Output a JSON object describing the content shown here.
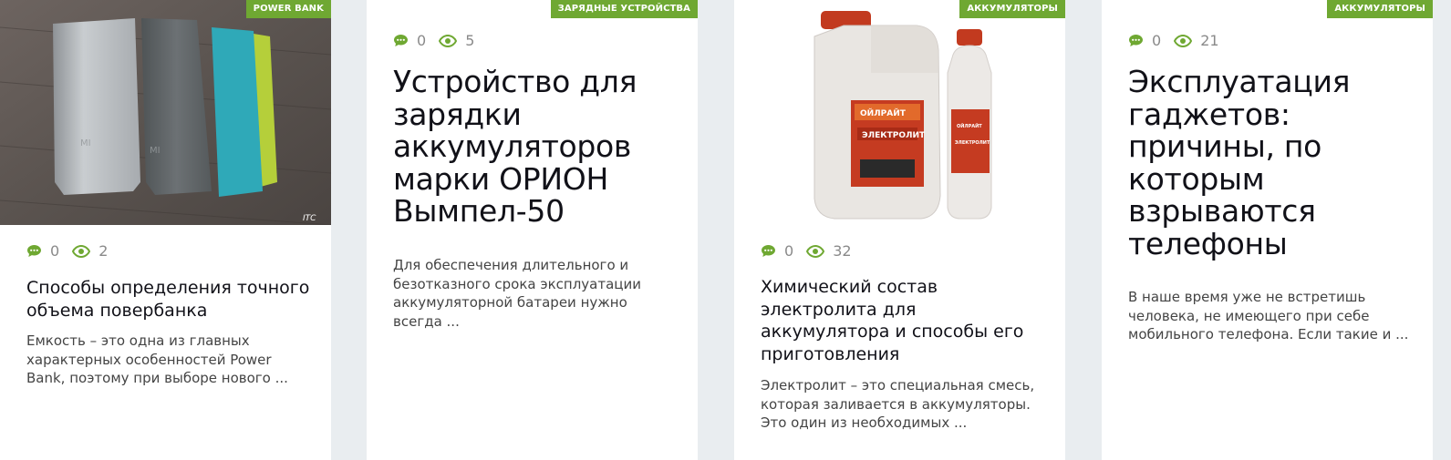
{
  "accent_color": "#6fa832",
  "cards": [
    {
      "category": "Power Bank",
      "comments": "0",
      "views": "2",
      "title": "Способы определения точного объема повербанка",
      "excerpt": "Емкость – это одна из главных характерных особенностей Power Bank, поэтому при выборе нового ...",
      "image_caption": "ITC"
    },
    {
      "category": "Зарядные устройства",
      "comments": "0",
      "views": "5",
      "title": "Устройство для зарядки аккумуляторов марки ОРИОН Вымпел-50",
      "excerpt": "Для обеспечения длительного и безотказного срока эксплуатации аккумуляторной батареи нужно всегда ..."
    },
    {
      "category": "Аккумуляторы",
      "comments": "0",
      "views": "32",
      "title": "Химический состав электролита для аккумулятора и способы его приготовления",
      "excerpt": "Электролит – это специальная смесь, которая заливается в аккумуляторы. Это один из необходимых ...",
      "image_brand": "ОЙЛРАЙТ",
      "image_label": "ЭЛЕКТРОЛИТ"
    },
    {
      "category": "Аккумуляторы",
      "comments": "0",
      "views": "21",
      "title": "Эксплуатация гаджетов: причины, по которым взрываются телефоны",
      "excerpt": "В наше время уже не встретишь человека, не имеющего при себе мобильного телефона. Если такие и ..."
    }
  ]
}
